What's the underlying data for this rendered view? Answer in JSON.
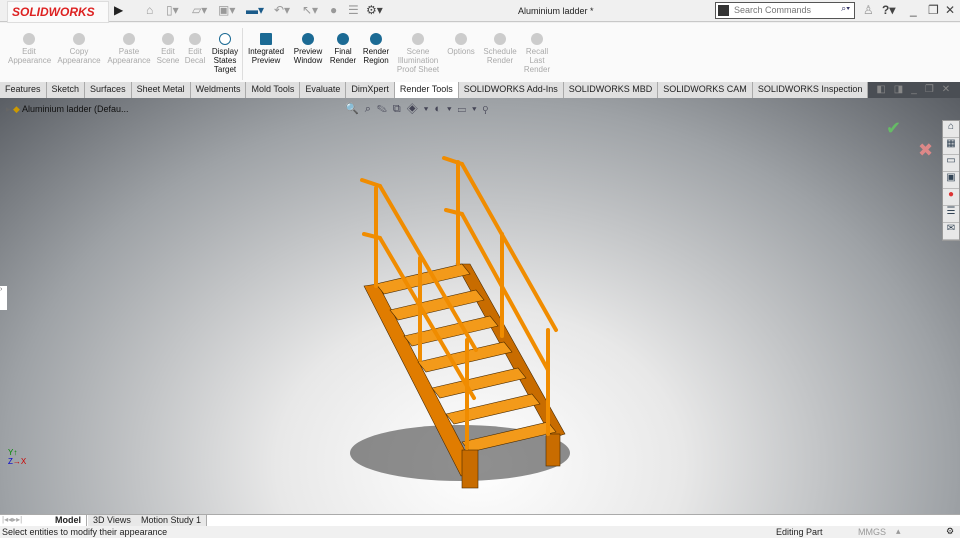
{
  "app": {
    "logo": "SOLIDWORKS",
    "title": "Aluminium ladder *"
  },
  "search": {
    "placeholder": "Search Commands"
  },
  "ribbon": [
    {
      "label": "Edit Appearance",
      "enabled": false
    },
    {
      "label": "Copy Appearance",
      "enabled": false
    },
    {
      "label": "Paste Appearance",
      "enabled": false
    },
    {
      "label": "Edit Scene",
      "enabled": false
    },
    {
      "label": "Edit Decal",
      "enabled": false
    },
    {
      "label": "Display States Target",
      "enabled": true
    },
    {
      "label": "Integrated Preview",
      "enabled": true
    },
    {
      "label": "Preview Window",
      "enabled": true
    },
    {
      "label": "Final Render",
      "enabled": true
    },
    {
      "label": "Render Region",
      "enabled": true
    },
    {
      "label": "Scene Illumination Proof Sheet",
      "enabled": false
    },
    {
      "label": "Options",
      "enabled": false
    },
    {
      "label": "Schedule Render",
      "enabled": false
    },
    {
      "label": "Recall Last Render",
      "enabled": false
    }
  ],
  "tabs": [
    "Features",
    "Sketch",
    "Surfaces",
    "Sheet Metal",
    "Weldments",
    "Mold Tools",
    "Evaluate",
    "DimXpert",
    "Render Tools",
    "SOLIDWORKS Add-Ins",
    "SOLIDWORKS MBD",
    "SOLIDWORKS CAM",
    "SOLIDWORKS Inspection"
  ],
  "active_tab": "Render Tools",
  "tree": {
    "root": "Aluminium ladder  (Defau..."
  },
  "bottom_tabs": [
    "Model",
    "3D Views",
    "Motion Study 1"
  ],
  "status": {
    "message": "Select entities to modify their appearance",
    "mode": "Editing Part",
    "units": "MMGS"
  },
  "colors": {
    "part": "#f08c00",
    "logo": "#d22222"
  }
}
